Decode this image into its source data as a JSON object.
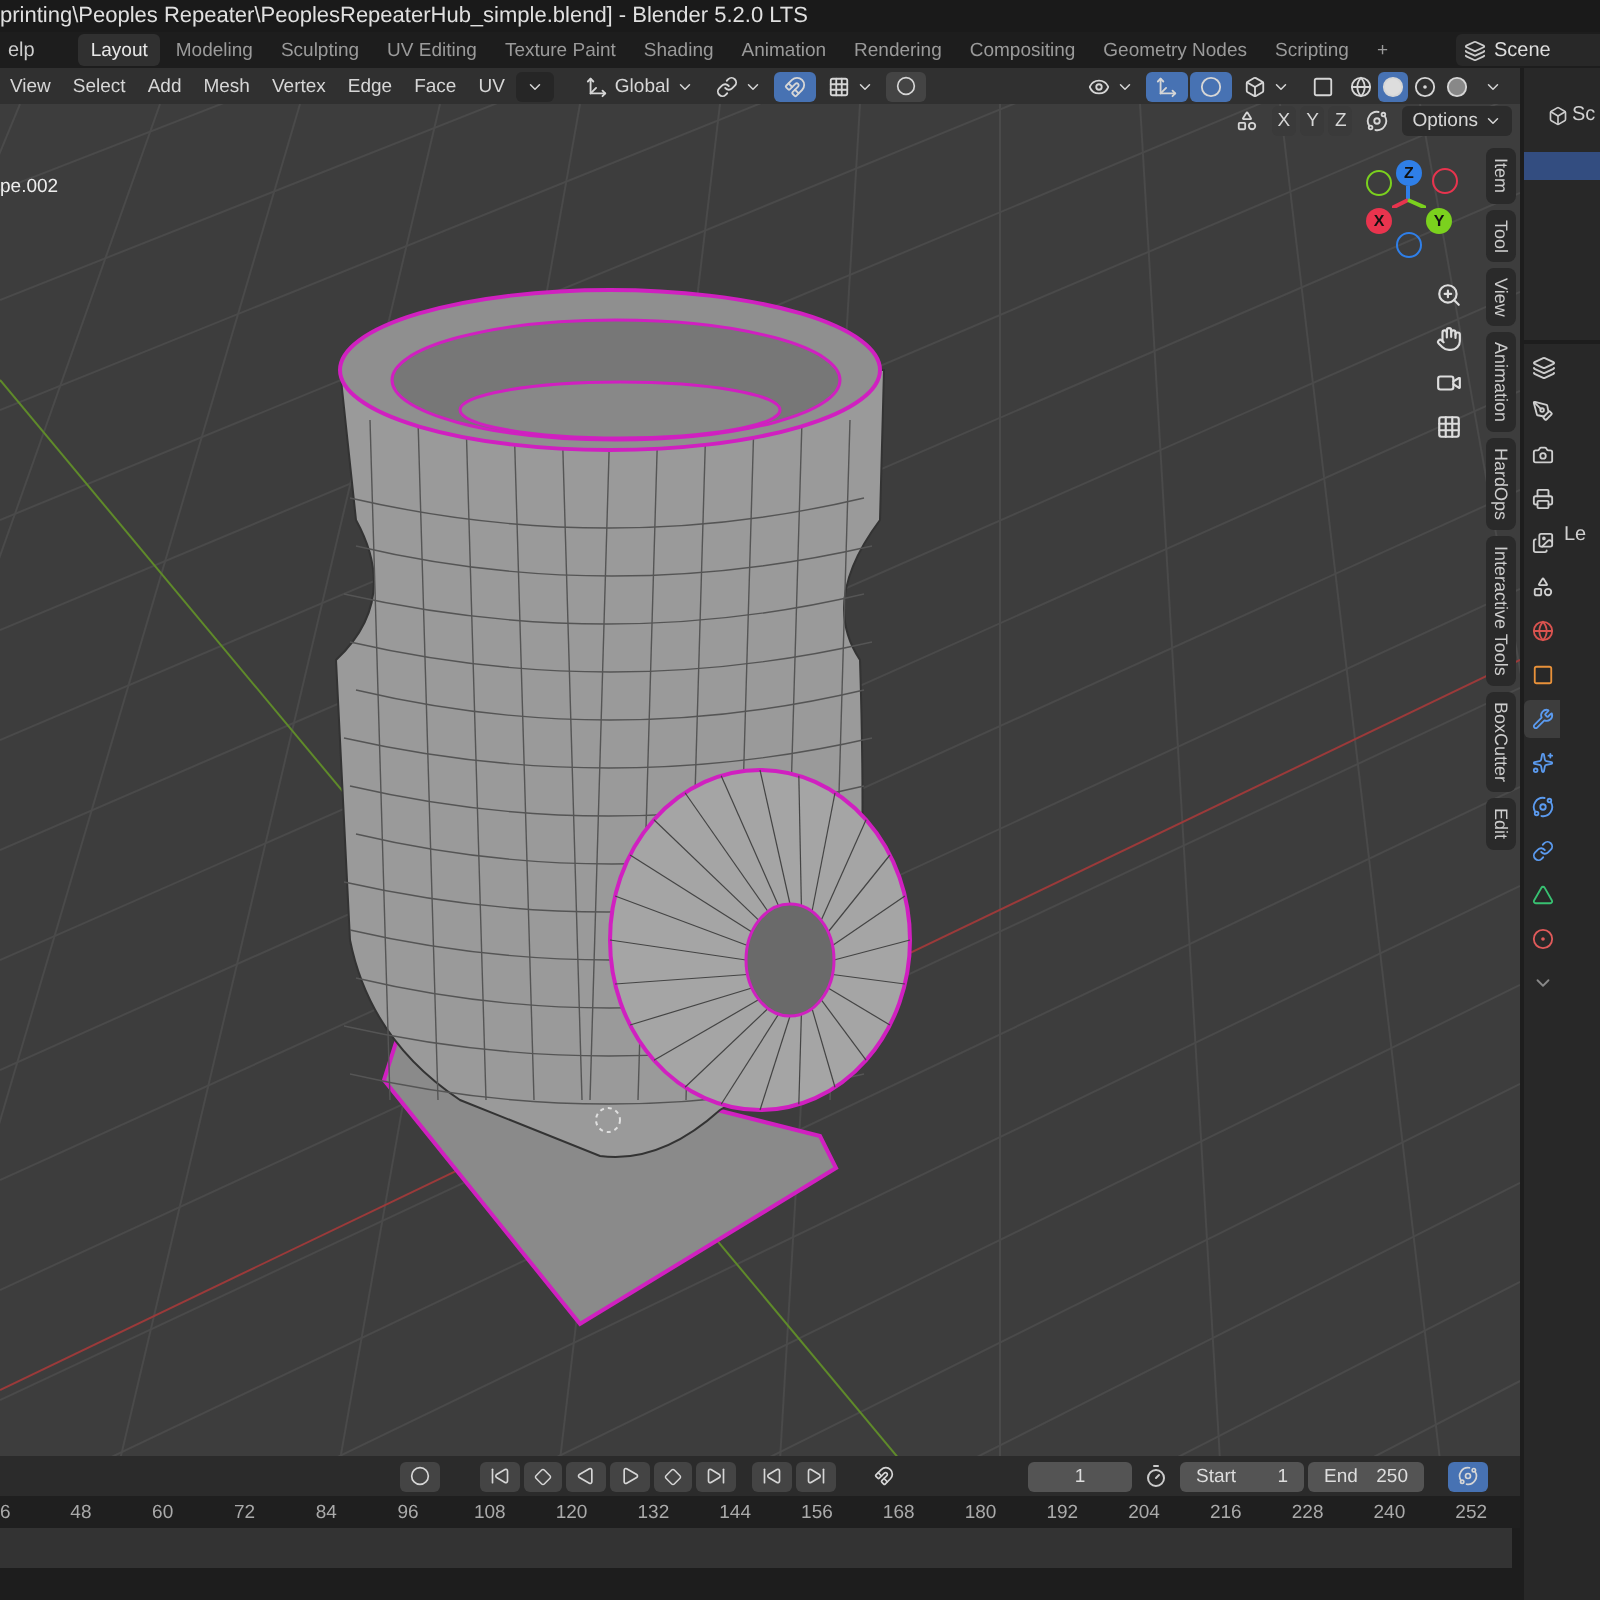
{
  "title_bar": {
    "title": "printing\\Peoples Repeater\\PeoplesRepeaterHub_simple.blend] - Blender 5.2.0 LTS"
  },
  "top_bar": {
    "menu": "elp",
    "workspaces": [
      {
        "label": "Layout",
        "selected": true
      },
      {
        "label": "Modeling",
        "selected": false
      },
      {
        "label": "Sculpting",
        "selected": false
      },
      {
        "label": "UV Editing",
        "selected": false
      },
      {
        "label": "Texture Paint",
        "selected": false
      },
      {
        "label": "Shading",
        "selected": false
      },
      {
        "label": "Animation",
        "selected": false
      },
      {
        "label": "Rendering",
        "selected": false
      },
      {
        "label": "Compositing",
        "selected": false
      },
      {
        "label": "Geometry Nodes",
        "selected": false
      },
      {
        "label": "Scripting",
        "selected": false
      }
    ],
    "add_tab": "+",
    "scene": "Scene"
  },
  "viewport_header": {
    "menus": [
      "View",
      "Select",
      "Add",
      "Mesh",
      "Vertex",
      "Edge",
      "Face",
      "UV"
    ],
    "orientation": "Global",
    "snap_on": true,
    "shading": [
      {
        "kind": "wireframe",
        "selected": false
      },
      {
        "kind": "solid",
        "selected": true
      },
      {
        "kind": "material",
        "selected": false
      },
      {
        "kind": "rendered",
        "selected": false
      }
    ],
    "axes": [
      "X",
      "Y",
      "Z"
    ],
    "options": "Options"
  },
  "viewport": {
    "object_name": "pe.002",
    "gizmo": [
      {
        "label": "Z",
        "color": "#2f7fe8"
      },
      {
        "label": "X",
        "color": "#e8344e"
      },
      {
        "label": "Y",
        "color": "#7bd11e"
      }
    ],
    "side_tabs": [
      "Item",
      "Tool",
      "View",
      "Animation",
      "HardOps",
      "Interactive Tools",
      "BoxCutter",
      "Edit"
    ]
  },
  "outliner": {
    "scene_label": "Sc",
    "rows": [
      {
        "selected": true
      }
    ]
  },
  "properties": {
    "label": "Le",
    "tabs": [
      {
        "kind": "tool",
        "selected": false
      },
      {
        "kind": "render",
        "selected": false
      },
      {
        "kind": "output",
        "selected": false
      },
      {
        "kind": "view_layer",
        "selected": false
      },
      {
        "kind": "scene",
        "selected": false
      },
      {
        "kind": "world",
        "selected": false
      },
      {
        "kind": "object",
        "selected": false
      },
      {
        "kind": "modifiers",
        "selected": true
      },
      {
        "kind": "particles",
        "selected": false
      },
      {
        "kind": "physics",
        "selected": false
      },
      {
        "kind": "constraints",
        "selected": false
      },
      {
        "kind": "data",
        "selected": false
      },
      {
        "kind": "material",
        "selected": false
      },
      {
        "kind": "more",
        "selected": false
      }
    ]
  },
  "timeline": {
    "current_frame": "1",
    "start_label": "Start",
    "start": "1",
    "end_label": "End",
    "end": "250",
    "ruler": [
      "6",
      "48",
      "60",
      "72",
      "84",
      "96",
      "108",
      "120",
      "132",
      "144",
      "156",
      "168",
      "180",
      "192",
      "204",
      "216",
      "228",
      "240",
      "252"
    ]
  }
}
